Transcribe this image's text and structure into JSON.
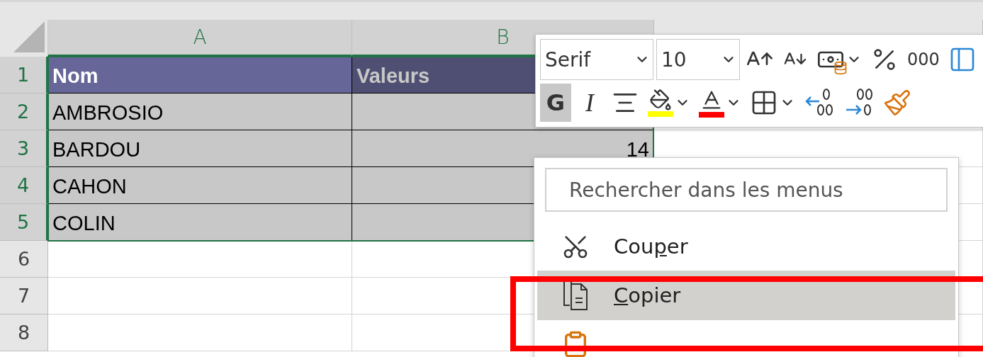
{
  "columns": [
    {
      "label": "A",
      "selected": true
    },
    {
      "label": "B",
      "selected": true
    }
  ],
  "rows": [
    {
      "number": "1",
      "selected": true,
      "kind": "header",
      "cells": [
        "Nom",
        "Valeurs"
      ]
    },
    {
      "number": "2",
      "selected": true,
      "kind": "data",
      "cells": [
        "AMBROSIO"
      ]
    },
    {
      "number": "3",
      "selected": true,
      "kind": "data",
      "cells": [
        "BARDOU",
        "14"
      ]
    },
    {
      "number": "4",
      "selected": true,
      "kind": "data",
      "cells": [
        "CAHON"
      ]
    },
    {
      "number": "5",
      "selected": true,
      "kind": "data",
      "cells": [
        "COLIN"
      ]
    },
    {
      "number": "6",
      "selected": false,
      "kind": "blank"
    },
    {
      "number": "7",
      "selected": false,
      "kind": "blank"
    },
    {
      "number": "8",
      "selected": false,
      "kind": "blank"
    }
  ],
  "mini_toolbar": {
    "font": {
      "value": "Serif"
    },
    "size": {
      "value": "10"
    },
    "row1": [
      {
        "kind": "grow-font"
      },
      {
        "kind": "shrink-font"
      },
      {
        "kind": "accounting",
        "dropdown": true
      },
      {
        "kind": "percent"
      },
      {
        "kind": "thousands",
        "label": "000"
      },
      {
        "kind": "side-panel"
      }
    ],
    "row2": [
      {
        "kind": "bold",
        "label": "G",
        "selected": true
      },
      {
        "kind": "italic",
        "label": "I",
        "selected": false
      },
      {
        "kind": "align-center"
      },
      {
        "kind": "fill-color",
        "color": "#ffff00",
        "dropdown": true
      },
      {
        "kind": "font-color",
        "color": "#ff0000",
        "dropdown": true
      },
      {
        "kind": "borders",
        "dropdown": true
      },
      {
        "kind": "increase-decimal"
      },
      {
        "kind": "decrease-decimal"
      },
      {
        "kind": "format-painter"
      }
    ]
  },
  "context_menu": {
    "search": {
      "placeholder": "Rechercher dans les menus"
    },
    "items": [
      {
        "kind": "scissors",
        "selected": false,
        "label_parts": [
          {
            "text": "Cou"
          },
          {
            "text": "p",
            "underline": true
          },
          {
            "text": "er"
          }
        ]
      },
      {
        "kind": "copy",
        "selected": true,
        "label_parts": [
          {
            "text": "C",
            "underline": true
          },
          {
            "text": "opier"
          }
        ]
      },
      {
        "kind": "paste",
        "selected": false
      }
    ]
  }
}
